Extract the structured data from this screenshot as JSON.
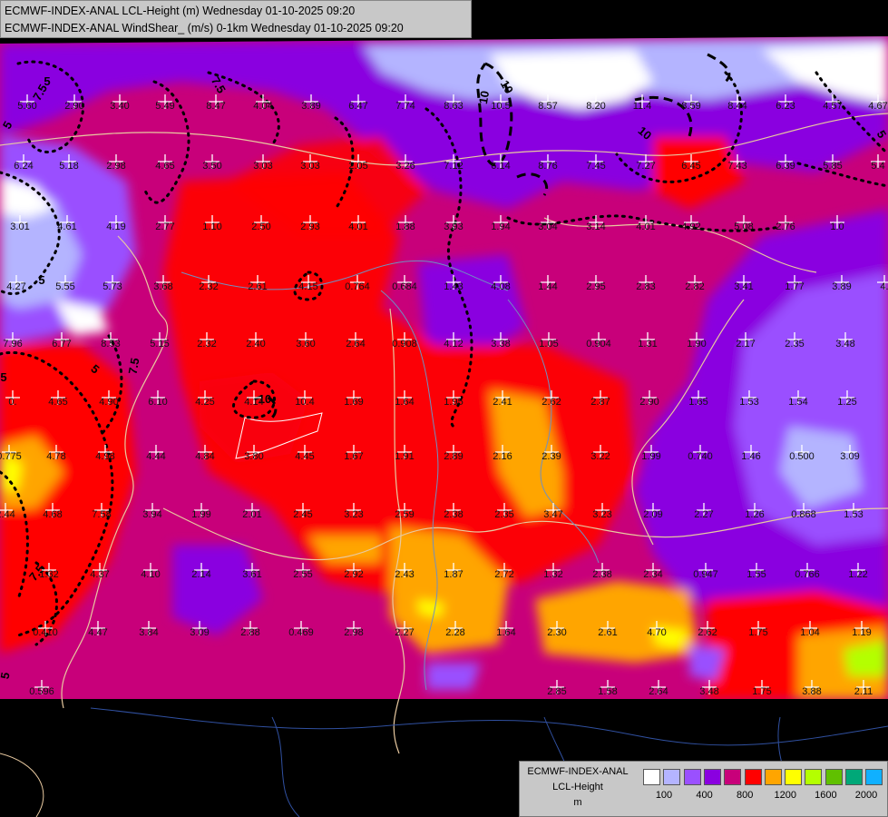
{
  "header": {
    "line1": "ECMWF-INDEX-ANAL LCL-Height (m) Wednesday 01-10-2025 09:20",
    "line2": "ECMWF-INDEX-ANAL WindShear_ (m/s) 0-1km Wednesday 01-10-2025 09:20"
  },
  "legend": {
    "line1": "ECMWF-INDEX-ANAL",
    "line2": "LCL-Height",
    "line3": "m",
    "colors": [
      "#ffffff",
      "#b4b4ff",
      "#9a50ff",
      "#8a00e0",
      "#c8007a",
      "#ff0000",
      "#ffa500",
      "#ffff00",
      "#b4ff00",
      "#60c000",
      "#00a878",
      "#10b0ff"
    ],
    "ticks": [
      "100",
      "400",
      "800",
      "1200",
      "1600",
      "2000"
    ]
  },
  "contour_labels": [
    "5",
    "7.5",
    "7.5",
    "10",
    "10",
    "10",
    "5",
    "5",
    "5",
    "5",
    "7.5",
    "10",
    "5",
    "7.5",
    "5"
  ],
  "values": [
    {
      "v": "5.60"
    },
    {
      "v": "2.90"
    },
    {
      "v": "3.40"
    },
    {
      "v": "5.49"
    },
    {
      "v": "8.47"
    },
    {
      "v": "4.04"
    },
    {
      "v": "3.89"
    },
    {
      "v": "6.47"
    },
    {
      "v": "7.74"
    },
    {
      "v": "8.63"
    },
    {
      "v": "10.5"
    },
    {
      "v": "8.57"
    },
    {
      "v": "8.20"
    },
    {
      "v": "11.4"
    },
    {
      "v": "8.59"
    },
    {
      "v": "8.44"
    },
    {
      "v": "6.23"
    },
    {
      "v": "4.57"
    },
    {
      "v": "4.67"
    },
    {
      "v": "6.24"
    },
    {
      "v": "5.18"
    },
    {
      "v": "2.98"
    },
    {
      "v": "4.65"
    },
    {
      "v": "3.50"
    },
    {
      "v": "3.03"
    },
    {
      "v": "3.03"
    },
    {
      "v": "2.05"
    },
    {
      "v": "3.26"
    },
    {
      "v": "7.12"
    },
    {
      "v": "6.14"
    },
    {
      "v": "8.76"
    },
    {
      "v": "7.45"
    },
    {
      "v": "7.27"
    },
    {
      "v": "6.45"
    },
    {
      "v": "7.43"
    },
    {
      "v": "6.39"
    },
    {
      "v": "5.85"
    },
    {
      "v": "5.4"
    },
    {
      "v": "3.01"
    },
    {
      "v": "4.61"
    },
    {
      "v": "4.19"
    },
    {
      "v": "2.77"
    },
    {
      "v": "1.10"
    },
    {
      "v": "2.50"
    },
    {
      "v": "2.93"
    },
    {
      "v": "4.01"
    },
    {
      "v": "1.88"
    },
    {
      "v": "3.93"
    },
    {
      "v": "1.94"
    },
    {
      "v": "3.04"
    },
    {
      "v": "3.14"
    },
    {
      "v": "4.01"
    },
    {
      "v": "4.92"
    },
    {
      "v": "5.08"
    },
    {
      "v": "2.76"
    },
    {
      "v": "1.0"
    },
    {
      "v": "4.27"
    },
    {
      "v": "5.55"
    },
    {
      "v": "5.73"
    },
    {
      "v": "3.68"
    },
    {
      "v": "2.32"
    },
    {
      "v": "2.61"
    },
    {
      "v": "4.15"
    },
    {
      "v": "0.764"
    },
    {
      "v": "0.684"
    },
    {
      "v": "1.43"
    },
    {
      "v": "4.08"
    },
    {
      "v": "1.44"
    },
    {
      "v": "2.95"
    },
    {
      "v": "2.83"
    },
    {
      "v": "2.82"
    },
    {
      "v": "3.41"
    },
    {
      "v": "1.77"
    },
    {
      "v": "3.89"
    },
    {
      "v": "4."
    },
    {
      "v": "7.96"
    },
    {
      "v": "6.77"
    },
    {
      "v": "8.53"
    },
    {
      "v": "5.15"
    },
    {
      "v": "2.32"
    },
    {
      "v": "2.40"
    },
    {
      "v": "3.60"
    },
    {
      "v": "2.64"
    },
    {
      "v": "0.908"
    },
    {
      "v": "4.12"
    },
    {
      "v": "3.38"
    },
    {
      "v": "1.05"
    },
    {
      "v": "0.904"
    },
    {
      "v": "1.31"
    },
    {
      "v": "1.90"
    },
    {
      "v": "2.17"
    },
    {
      "v": "2.35"
    },
    {
      "v": "3.48"
    },
    {
      "v": "0."
    },
    {
      "v": "4.65"
    },
    {
      "v": "4.90"
    },
    {
      "v": "6.10"
    },
    {
      "v": "4.25"
    },
    {
      "v": "4.14"
    },
    {
      "v": "10.4"
    },
    {
      "v": "1.69"
    },
    {
      "v": "1.64"
    },
    {
      "v": "1.95"
    },
    {
      "v": "2.41"
    },
    {
      "v": "2.62"
    },
    {
      "v": "2.87"
    },
    {
      "v": "2.90"
    },
    {
      "v": "1.65"
    },
    {
      "v": "1.53"
    },
    {
      "v": "1.54"
    },
    {
      "v": "1.25"
    },
    {
      "v": "0.775"
    },
    {
      "v": "4.78"
    },
    {
      "v": "4.98"
    },
    {
      "v": "4.44"
    },
    {
      "v": "4.84"
    },
    {
      "v": "3.80"
    },
    {
      "v": "4.45"
    },
    {
      "v": "1.67"
    },
    {
      "v": "1.91"
    },
    {
      "v": "2.89"
    },
    {
      "v": "2.16"
    },
    {
      "v": "2.39"
    },
    {
      "v": "3.22"
    },
    {
      "v": "1.99"
    },
    {
      "v": "0.740"
    },
    {
      "v": "1.46"
    },
    {
      "v": "0.500"
    },
    {
      "v": "3.09"
    },
    {
      "v": "2.44"
    },
    {
      "v": "4.68"
    },
    {
      "v": "7.58"
    },
    {
      "v": "3.94"
    },
    {
      "v": "1.99"
    },
    {
      "v": "2.01"
    },
    {
      "v": "2.45"
    },
    {
      "v": "3.23"
    },
    {
      "v": "2.59"
    },
    {
      "v": "2.38"
    },
    {
      "v": "2.35"
    },
    {
      "v": "3.47"
    },
    {
      "v": "3.23"
    },
    {
      "v": "2.09"
    },
    {
      "v": "2.27"
    },
    {
      "v": "1.26"
    },
    {
      "v": "0.868"
    },
    {
      "v": "1.53"
    },
    {
      "v": "1.32"
    },
    {
      "v": "4.37"
    },
    {
      "v": "4.10"
    },
    {
      "v": "2.14"
    },
    {
      "v": "3.61"
    },
    {
      "v": "2.55"
    },
    {
      "v": "2.92"
    },
    {
      "v": "2.43"
    },
    {
      "v": "1.87"
    },
    {
      "v": "2.72"
    },
    {
      "v": "1.32"
    },
    {
      "v": "2.38"
    },
    {
      "v": "2.34"
    },
    {
      "v": "0.947"
    },
    {
      "v": "1.55"
    },
    {
      "v": "0.766"
    },
    {
      "v": "1.22"
    },
    {
      "v": "0.410"
    },
    {
      "v": "4.47"
    },
    {
      "v": "3.84"
    },
    {
      "v": "3.09"
    },
    {
      "v": "2.88"
    },
    {
      "v": "0.469"
    },
    {
      "v": "2.98"
    },
    {
      "v": "2.27"
    },
    {
      "v": "2.28"
    },
    {
      "v": "1.64"
    },
    {
      "v": "2.30"
    },
    {
      "v": "2.61"
    },
    {
      "v": "4.70"
    },
    {
      "v": "2.62"
    },
    {
      "v": "1.75"
    },
    {
      "v": "1.04"
    },
    {
      "v": "1.19"
    },
    {
      "v": "0.596"
    },
    {
      "v": "2.85"
    },
    {
      "v": "1.58"
    },
    {
      "v": "2.64"
    },
    {
      "v": "3.48"
    },
    {
      "v": "1.75"
    },
    {
      "v": "3.88"
    },
    {
      "v": "2.11"
    },
    {
      "v": "4.29"
    }
  ]
}
